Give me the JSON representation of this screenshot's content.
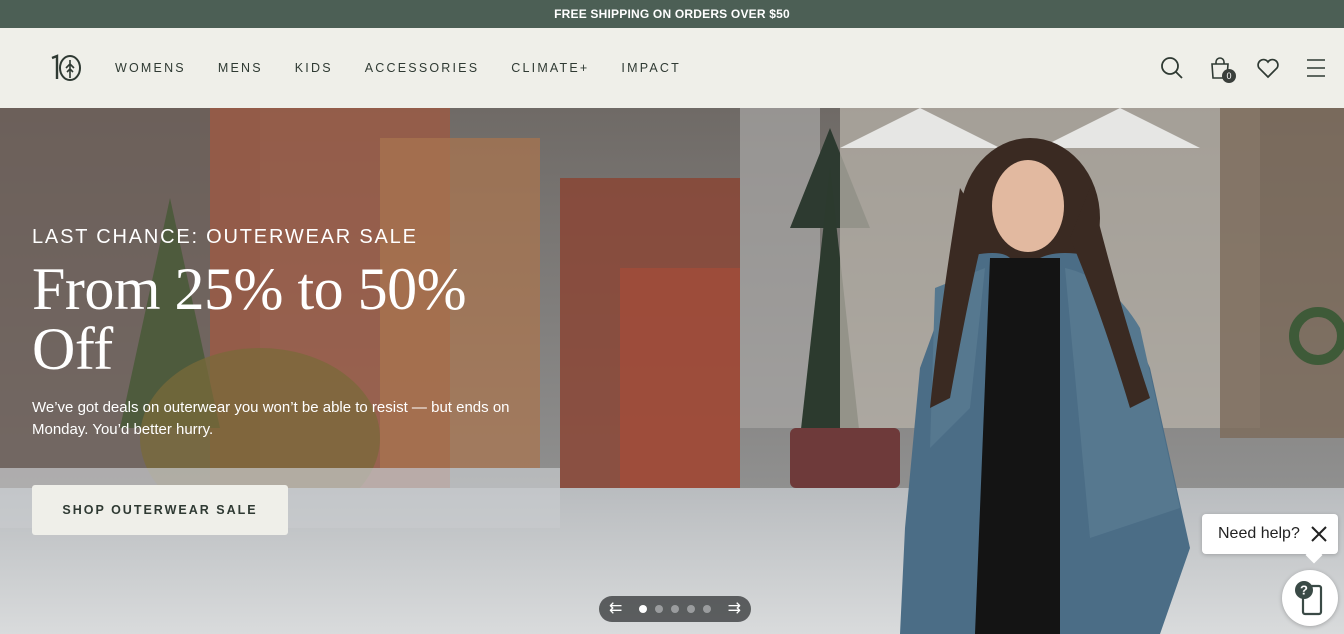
{
  "promo": {
    "text": "FREE SHIPPING ON ORDERS OVER $50"
  },
  "header": {
    "logo_text": "10",
    "nav": [
      "WOMENS",
      "MENS",
      "KIDS",
      "ACCESSORIES",
      "CLIMATE+",
      "IMPACT"
    ],
    "cart_count": "0"
  },
  "hero": {
    "eyebrow": "LAST CHANCE: OUTERWEAR SALE",
    "headline_line1": "From 25% to 50%",
    "headline_line2": "Off",
    "subcopy": "We’ve got deals on outerwear you won’t be able to resist — but ends on Monday. You’d better hurry.",
    "cta_label": "SHOP OUTERWEAR SALE"
  },
  "carousel": {
    "slides": 5,
    "active": 1
  },
  "help": {
    "label": "Need help?",
    "launcher_glyph": "?"
  },
  "colors": {
    "promo_bg": "#4c5f55",
    "header_bg": "#efefe9",
    "ink": "#2f3a33"
  }
}
